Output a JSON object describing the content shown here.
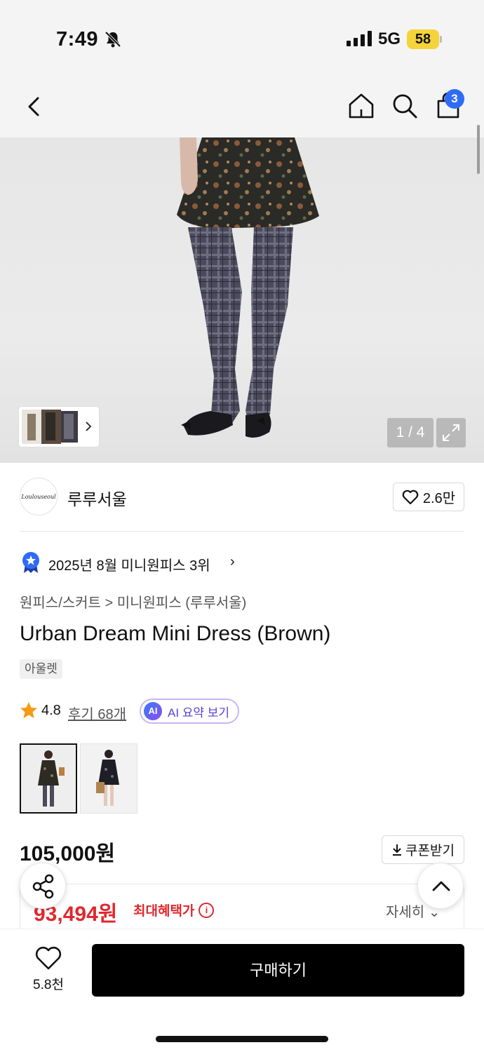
{
  "status_bar": {
    "time": "7:49",
    "network": "5G",
    "battery": "58"
  },
  "nav": {
    "cart_count": "3"
  },
  "gallery": {
    "counter": "1 / 4"
  },
  "brand": {
    "logo_text": "Loulouseoul",
    "name": "루루서울",
    "likes": "2.6만"
  },
  "ranking": {
    "text": "2025년 8월 미니원피스 3위",
    "chevron": "›"
  },
  "breadcrumb": {
    "text": "원피스/스커트 > 미니원피스 (루루서울)"
  },
  "product": {
    "title": "Urban Dream Mini Dress (Brown)",
    "tag": "아울렛",
    "rating": "4.8",
    "reviews": "후기 68개",
    "ai_label": "AI 요약 보기",
    "ai_chip": "AI"
  },
  "price": {
    "original": "105,000원",
    "coupon": "쿠폰받기",
    "sale": "93,494원",
    "max_benefit": "최대혜택가",
    "info": "i",
    "detail": "자세히 ⌄"
  },
  "bottom": {
    "wish_count": "5.8천",
    "buy_label": "구매하기"
  },
  "colors": {
    "accent_blue": "#2f6cf6",
    "sale_red": "#e0282e",
    "battery_yellow": "#f5d33a"
  }
}
